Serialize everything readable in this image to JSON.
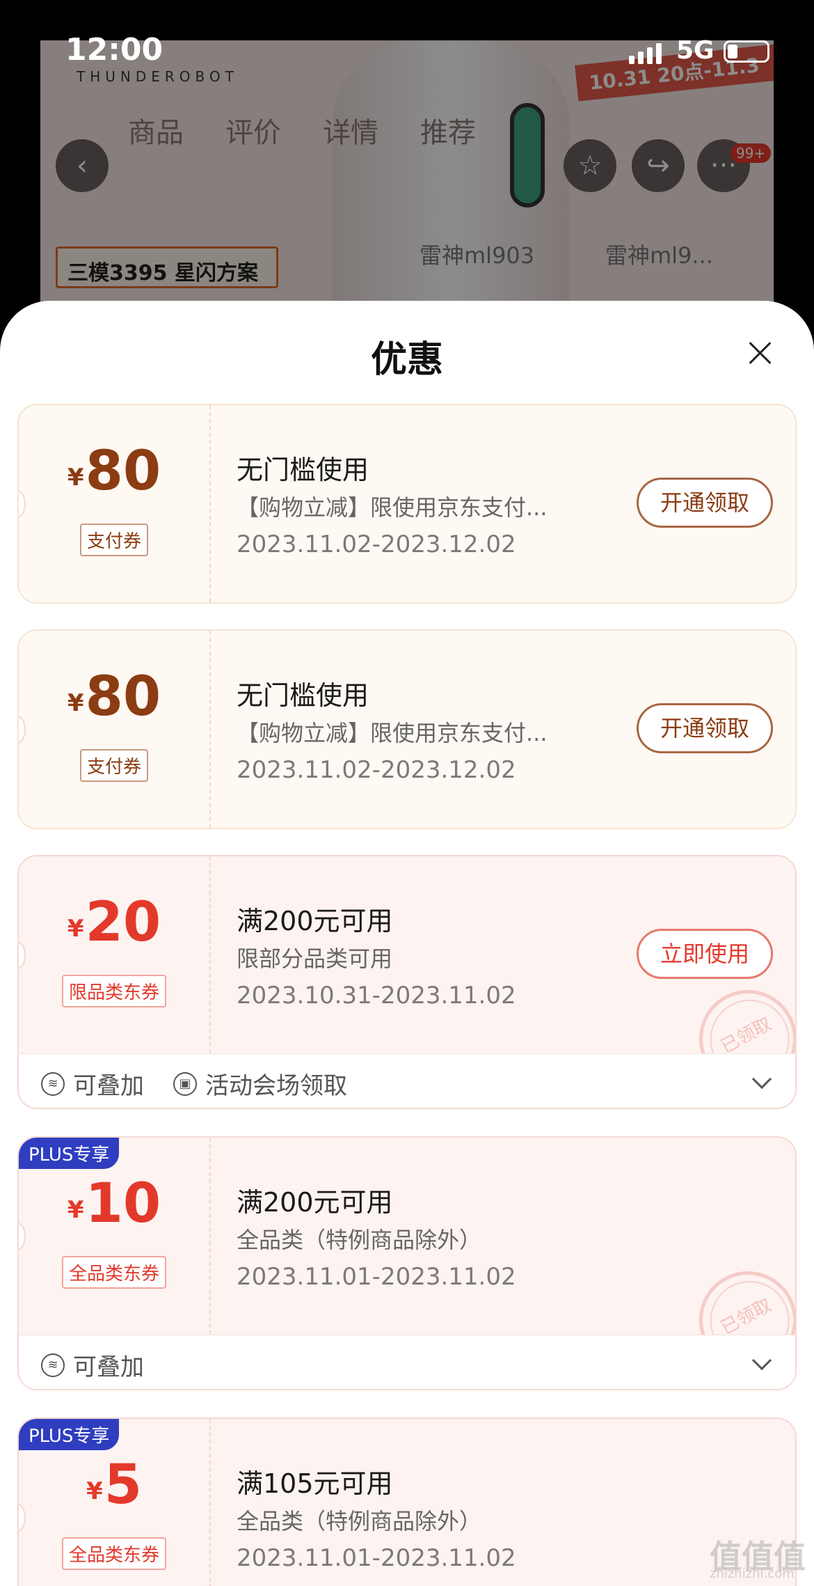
{
  "status_bar": {
    "time": "12:00",
    "network": "5G"
  },
  "background_page": {
    "brand": "THUNDEROBOT",
    "promo": "10.31 20点-11.3",
    "nav_tabs": [
      "商品",
      "评价",
      "详情",
      "推荐"
    ],
    "cart_badge": "99+",
    "product_tag": "三模3395 星闪方案",
    "related": [
      "雷神ml903",
      "雷神ml9..."
    ]
  },
  "sheet": {
    "title": "优惠"
  },
  "coupons": [
    {
      "currency": "¥",
      "amount": "80",
      "type_label": "支付券",
      "condition": "无门槛使用",
      "description": "【购物立减】限使用京东支付...",
      "date_range": "2023.11.02-2023.12.02",
      "button": "开通领取"
    },
    {
      "currency": "¥",
      "amount": "80",
      "type_label": "支付券",
      "condition": "无门槛使用",
      "description": "【购物立减】限使用京东支付...",
      "date_range": "2023.11.02-2023.12.02",
      "button": "开通领取"
    },
    {
      "currency": "¥",
      "amount": "20",
      "type_label": "限品类东券",
      "condition": "满200元可用",
      "description": "限部分品类可用",
      "date_range": "2023.10.31-2023.11.02",
      "button": "立即使用",
      "stamp": "已领取",
      "footer": [
        "可叠加",
        "活动会场领取"
      ]
    },
    {
      "badge": "PLUS专享",
      "currency": "¥",
      "amount": "10",
      "type_label": "全品类东券",
      "condition": "满200元可用",
      "description": "全品类（特例商品除外）",
      "date_range": "2023.11.01-2023.11.02",
      "stamp": "已领取",
      "footer": [
        "可叠加"
      ]
    },
    {
      "badge": "PLUS专享",
      "currency": "¥",
      "amount": "5",
      "type_label": "全品类东券",
      "condition": "满105元可用",
      "description": "全品类（特例商品除外）",
      "date_range": "2023.11.01-2023.11.02"
    }
  ],
  "watermark": {
    "main": "值值值",
    "sub": "zhizhizhi.com"
  },
  "colors": {
    "pay_brown": "#8b3c12",
    "jd_red": "#e3392b",
    "plus_blue": "#2f3ec0"
  }
}
